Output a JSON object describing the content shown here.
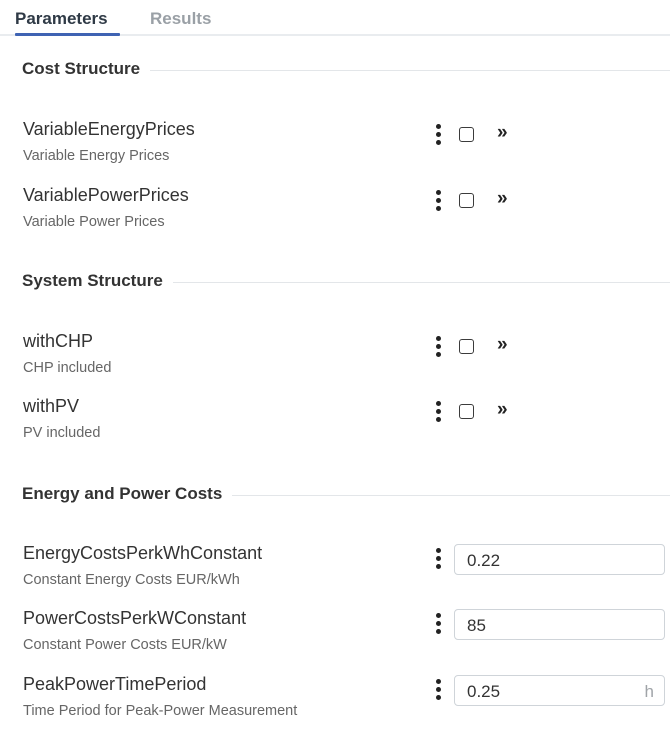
{
  "tabs": [
    {
      "label": "Parameters",
      "active": true
    },
    {
      "label": "Results",
      "active": false
    }
  ],
  "sections": [
    {
      "title": "Cost Structure",
      "params": [
        {
          "name": "VariableEnergyPrices",
          "description": "Variable Energy Prices",
          "type": "checkbox",
          "checked": false
        },
        {
          "name": "VariablePowerPrices",
          "description": "Variable Power Prices",
          "type": "checkbox",
          "checked": false
        }
      ]
    },
    {
      "title": "System Structure",
      "params": [
        {
          "name": "withCHP",
          "description": "CHP included",
          "type": "checkbox",
          "checked": false
        },
        {
          "name": "withPV",
          "description": "PV included",
          "type": "checkbox",
          "checked": false
        }
      ]
    },
    {
      "title": "Energy and Power Costs",
      "params": [
        {
          "name": "EnergyCostsPerkWhConstant",
          "description": "Constant Energy Costs EUR/kWh",
          "type": "number",
          "value": "0.22",
          "unit": ""
        },
        {
          "name": "PowerCostsPerkWConstant",
          "description": "Constant Power Costs EUR/kW",
          "type": "number",
          "value": "85",
          "unit": ""
        },
        {
          "name": "PeakPowerTimePeriod",
          "description": "Time Period for Peak-Power Measurement",
          "type": "number",
          "value": "0.25",
          "unit": "h"
        }
      ]
    }
  ],
  "icons": {
    "menu": "kebab-vertical-icon",
    "expand": "double-chevron-right-icon"
  },
  "colors": {
    "accent": "#3f63b3",
    "tab_inactive": "#9aa0a6",
    "divider": "#e3e6e9"
  }
}
